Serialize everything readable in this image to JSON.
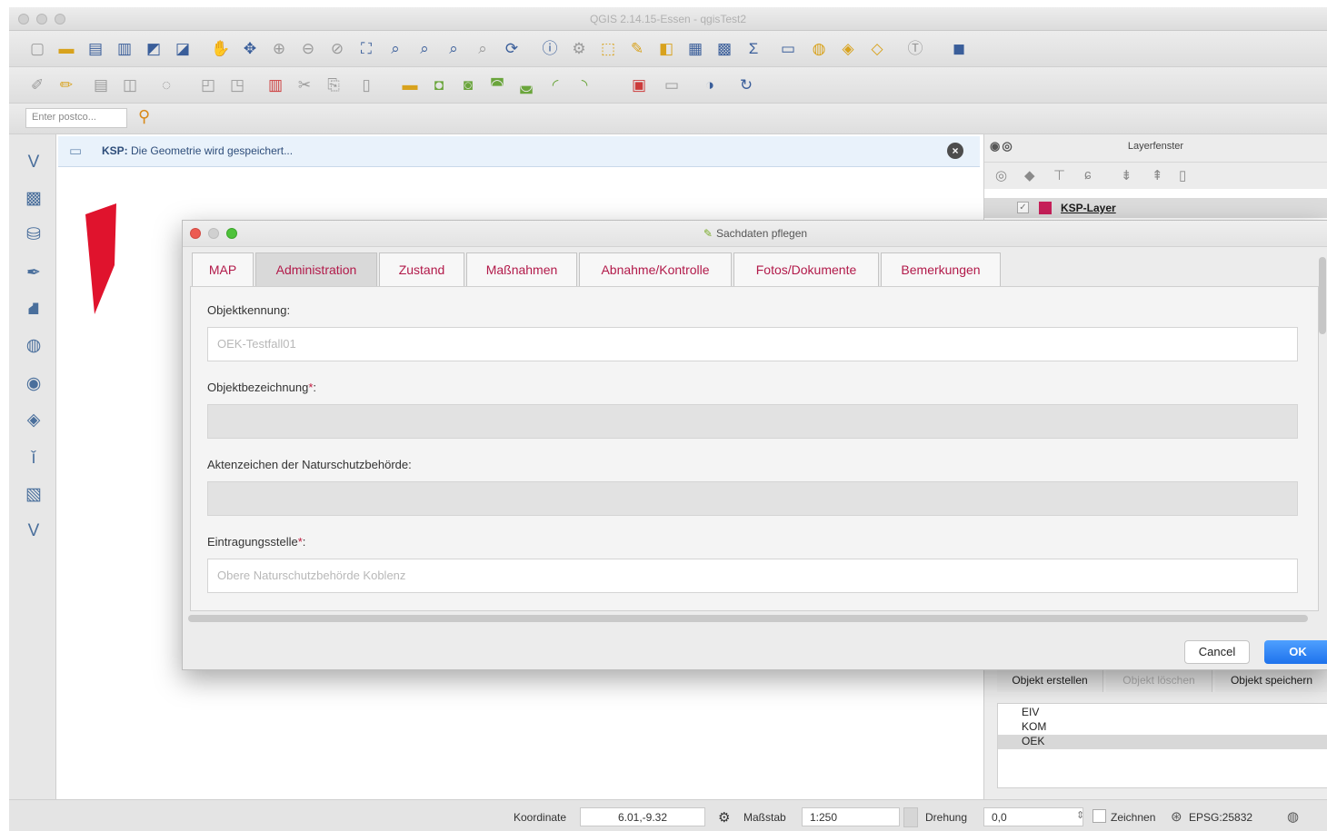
{
  "window": {
    "title": "QGIS 2.14.15-Essen - qgisTest2"
  },
  "locator": {
    "placeholder": "Enter postco..."
  },
  "message_bar": {
    "source": "KSP:",
    "text": "Die Geometrie wird gespeichert..."
  },
  "layer_panel": {
    "title": "Layerfenster",
    "layer_name": "KSP-Layer",
    "layer_color": "#c8205a",
    "actions": [
      "Objekt erstellen",
      "Objekt löschen",
      "Objekt speichern"
    ],
    "list_items": [
      "EIV",
      "KOM",
      "OEK"
    ],
    "selected_item": "OEK"
  },
  "dialog": {
    "title": "Sachdaten pflegen",
    "tabs": [
      "MAP",
      "Administration",
      "Zustand",
      "Maßnahmen",
      "Abnahme/Kontrolle",
      "Fotos/Dokumente",
      "Bemerkungen"
    ],
    "active_tab": "Administration",
    "fields": {
      "objektkennung": {
        "label": "Objektkennung:",
        "value": "OEK-Testfall01"
      },
      "objektbezeichnung": {
        "label": "Objektbezeichnung",
        "required_marker": "*",
        "label_suffix": ":",
        "value": ""
      },
      "aktenzeichen": {
        "label": "Aktenzeichen der Naturschutzbehörde:",
        "value": ""
      },
      "eintragungsstelle": {
        "label": "Eintragungsstelle",
        "required_marker": "*",
        "label_suffix": ":",
        "value": "Obere Naturschutzbehörde Koblenz"
      }
    },
    "cancel_label": "Cancel",
    "ok_label": "OK"
  },
  "status_bar": {
    "coordinate_label": "Koordinate",
    "coordinate_value": "6.01,-9.32",
    "scale_label": "Maßstab",
    "scale_value": "1:250",
    "rotation_label": "Drehung",
    "rotation_value": "0,0",
    "render_label": "Zeichnen",
    "crs_label": "EPSG:25832"
  },
  "colors": {
    "accent_tab_text": "#b21a4a",
    "ok_button": "#1e72ec",
    "required_marker": "#c0193e"
  }
}
